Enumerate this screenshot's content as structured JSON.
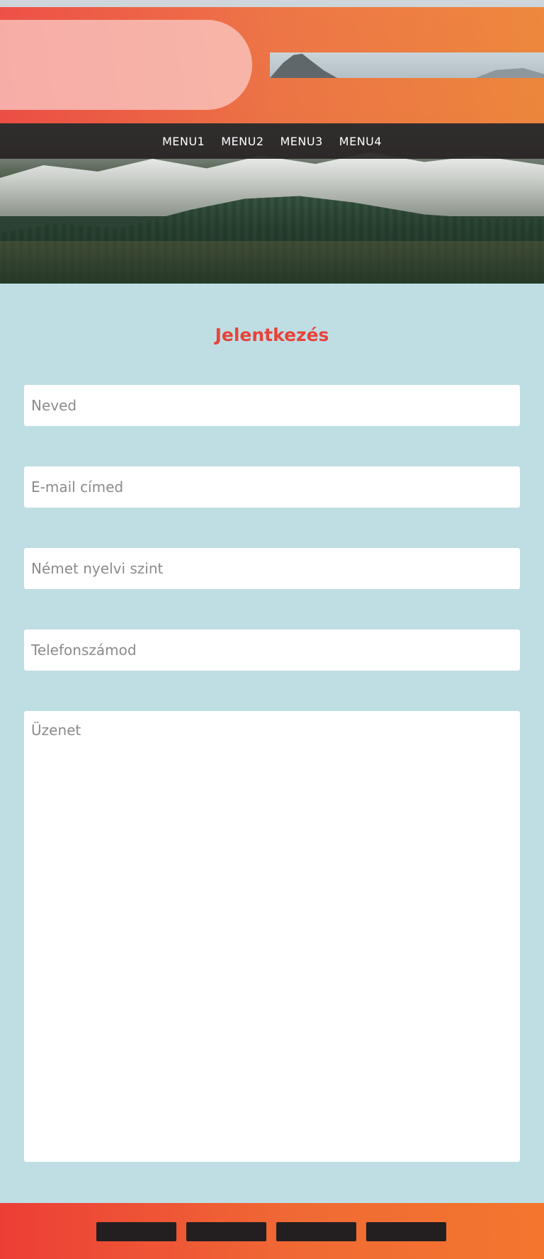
{
  "nav": {
    "items": [
      {
        "label": "MENU1"
      },
      {
        "label": "MENU2"
      },
      {
        "label": "MENU3"
      },
      {
        "label": "MENU4"
      }
    ]
  },
  "form": {
    "title": "Jelentkezés",
    "name_placeholder": "Neved",
    "email_placeholder": "E-mail címed",
    "level_placeholder": "Német nyelvi szint",
    "phone_placeholder": "Telefonszámod",
    "message_placeholder": "Üzenet"
  },
  "footer": {
    "buttons": [
      "",
      "",
      "",
      ""
    ]
  },
  "colors": {
    "accent": "#e8433a",
    "background": "#bedee4",
    "nav_background": "#262222",
    "footer_button": "#231f20"
  }
}
